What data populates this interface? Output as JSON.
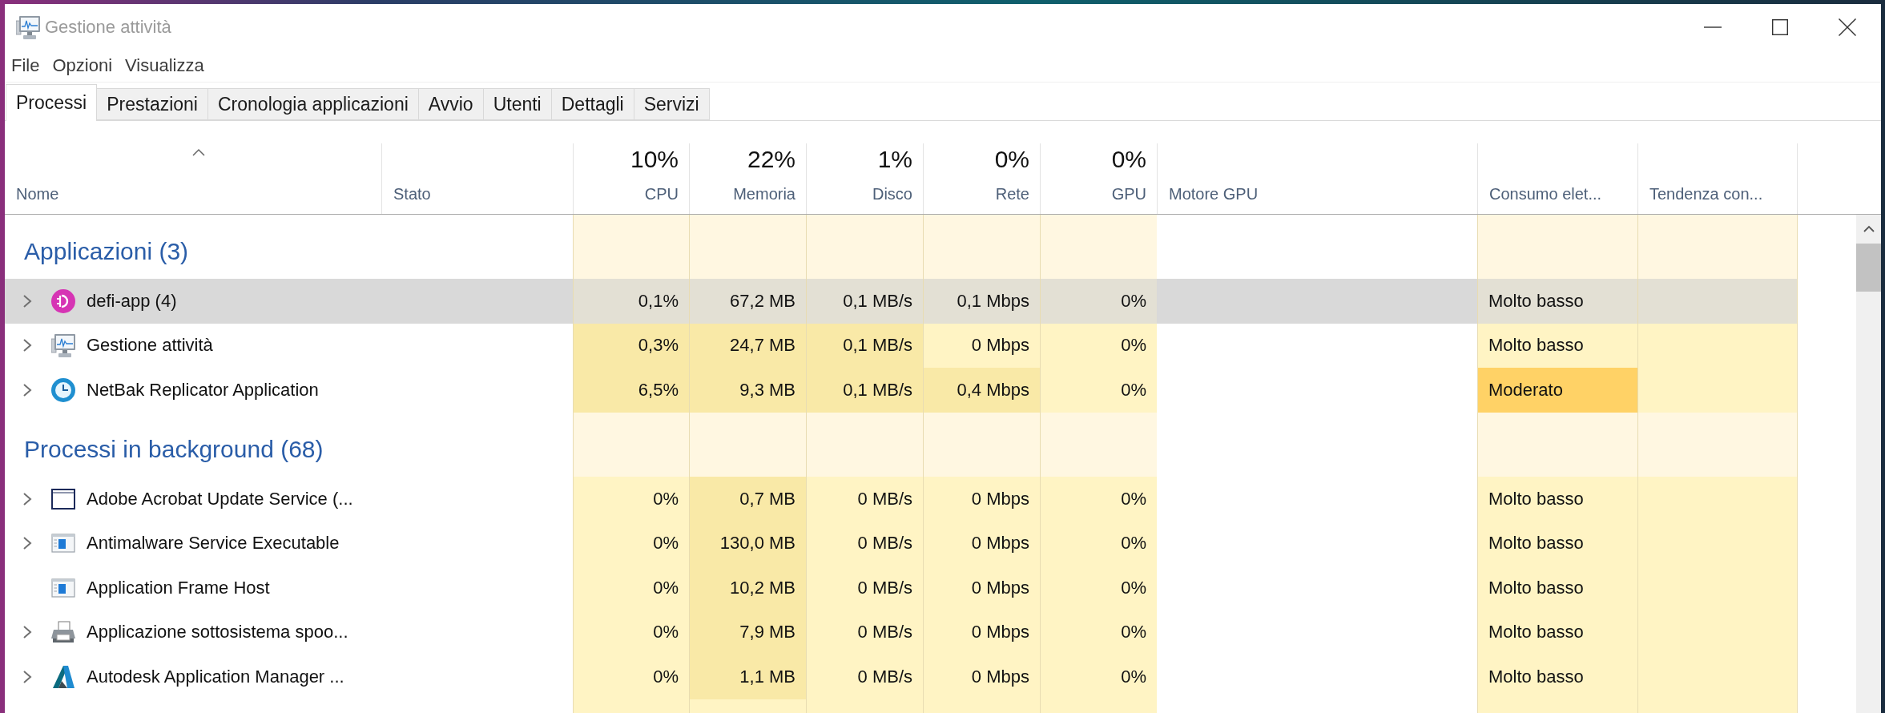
{
  "window": {
    "title": "Gestione attività"
  },
  "menu": [
    "File",
    "Opzioni",
    "Visualizza"
  ],
  "tabs": [
    {
      "label": "Processi",
      "selected": true
    },
    {
      "label": "Prestazioni",
      "selected": false
    },
    {
      "label": "Cronologia applicazioni",
      "selected": false
    },
    {
      "label": "Avvio",
      "selected": false
    },
    {
      "label": "Utenti",
      "selected": false
    },
    {
      "label": "Dettagli",
      "selected": false
    },
    {
      "label": "Servizi",
      "selected": false
    }
  ],
  "table": {
    "columns": [
      {
        "kind": "name",
        "label": "Nome",
        "sorted": true
      },
      {
        "kind": "status",
        "label": "Stato",
        "sorted": false
      },
      {
        "kind": "metric",
        "label": "CPU",
        "total": "10%",
        "sorted": false
      },
      {
        "kind": "metric",
        "label": "Memoria",
        "total": "22%",
        "sorted": false
      },
      {
        "kind": "metric",
        "label": "Disco",
        "total": "1%",
        "sorted": false
      },
      {
        "kind": "metric",
        "label": "Rete",
        "total": "0%",
        "sorted": false
      },
      {
        "kind": "metric",
        "label": "GPU",
        "total": "0%",
        "sorted": false
      },
      {
        "kind": "engine",
        "label": "Motore GPU",
        "sorted": false
      },
      {
        "kind": "power",
        "label": "Consumo elet...",
        "sorted": false
      },
      {
        "kind": "trend",
        "label": "Tendenza con...",
        "sorted": false
      }
    ],
    "groups": [
      {
        "title": "Applicazioni (3)",
        "rows": [
          {
            "name": "defi-app (4)",
            "expandable": true,
            "selected": true,
            "metrics": [
              {
                "text": "0,1%",
                "color": "#e3e0d4"
              },
              {
                "text": "67,2 MB",
                "color": "#e3e0d4"
              },
              {
                "text": "0,1 MB/s",
                "color": "#e3e0d4"
              },
              {
                "text": "0,1 Mbps",
                "color": "#e3e0d4"
              },
              {
                "text": "0%",
                "color": "#e3e0d4"
              }
            ],
            "power": {
              "text": "Molto basso",
              "color": "#e3e0d4"
            },
            "power_trend": {
              "color": "#e3e0d4"
            }
          },
          {
            "name": "Gestione attività",
            "expandable": true,
            "selected": false,
            "metrics": [
              {
                "text": "0,3%",
                "color": "#f9e9a7"
              },
              {
                "text": "24,7 MB",
                "color": "#f9e9a7"
              },
              {
                "text": "0,1 MB/s",
                "color": "#f9e9a7"
              },
              {
                "text": "0 Mbps",
                "color": "#fff4c4"
              },
              {
                "text": "0%",
                "color": "#fff4c4"
              }
            ],
            "power": {
              "text": "Molto basso",
              "color": "#fff4c4"
            },
            "power_trend": {
              "color": "#fff4c4"
            }
          },
          {
            "name": "NetBak Replicator Application",
            "expandable": true,
            "selected": false,
            "metrics": [
              {
                "text": "6,5%",
                "color": "#f9e9a7"
              },
              {
                "text": "9,3 MB",
                "color": "#f9e9a7"
              },
              {
                "text": "0,1 MB/s",
                "color": "#f9e9a7"
              },
              {
                "text": "0,4 Mbps",
                "color": "#f9e9a7"
              },
              {
                "text": "0%",
                "color": "#fff4c4"
              }
            ],
            "power": {
              "text": "Moderato",
              "color": "#ffd266"
            },
            "power_trend": {
              "color": "#fff4c4"
            }
          }
        ]
      },
      {
        "title": "Processi in background (68)",
        "rows": [
          {
            "name": "Adobe Acrobat Update Service (...",
            "expandable": true,
            "selected": false,
            "metrics": [
              {
                "text": "0%",
                "color": "#fff4c4"
              },
              {
                "text": "0,7 MB",
                "color": "#f9e9a7"
              },
              {
                "text": "0 MB/s",
                "color": "#fff4c4"
              },
              {
                "text": "0 Mbps",
                "color": "#fff4c4"
              },
              {
                "text": "0%",
                "color": "#fff4c4"
              }
            ],
            "power": {
              "text": "Molto basso",
              "color": "#fff4c4"
            },
            "power_trend": {
              "color": "#fff4c4"
            }
          },
          {
            "name": "Antimalware Service Executable",
            "expandable": true,
            "selected": false,
            "metrics": [
              {
                "text": "0%",
                "color": "#fff4c4"
              },
              {
                "text": "130,0 MB",
                "color": "#f9e9a7"
              },
              {
                "text": "0 MB/s",
                "color": "#fff4c4"
              },
              {
                "text": "0 Mbps",
                "color": "#fff4c4"
              },
              {
                "text": "0%",
                "color": "#fff4c4"
              }
            ],
            "power": {
              "text": "Molto basso",
              "color": "#fff4c4"
            },
            "power_trend": {
              "color": "#fff4c4"
            }
          },
          {
            "name": "Application Frame Host",
            "expandable": false,
            "selected": false,
            "metrics": [
              {
                "text": "0%",
                "color": "#fff4c4"
              },
              {
                "text": "10,2 MB",
                "color": "#f9e9a7"
              },
              {
                "text": "0 MB/s",
                "color": "#fff4c4"
              },
              {
                "text": "0 Mbps",
                "color": "#fff4c4"
              },
              {
                "text": "0%",
                "color": "#fff4c4"
              }
            ],
            "power": {
              "text": "Molto basso",
              "color": "#fff4c4"
            },
            "power_trend": {
              "color": "#fff4c4"
            }
          },
          {
            "name": "Applicazione sottosistema spoo...",
            "expandable": true,
            "selected": false,
            "metrics": [
              {
                "text": "0%",
                "color": "#fff4c4"
              },
              {
                "text": "7,9 MB",
                "color": "#f9e9a7"
              },
              {
                "text": "0 MB/s",
                "color": "#fff4c4"
              },
              {
                "text": "0 Mbps",
                "color": "#fff4c4"
              },
              {
                "text": "0%",
                "color": "#fff4c4"
              }
            ],
            "power": {
              "text": "Molto basso",
              "color": "#fff4c4"
            },
            "power_trend": {
              "color": "#fff4c4"
            }
          },
          {
            "name": "Autodesk Application Manager ...",
            "expandable": true,
            "selected": false,
            "metrics": [
              {
                "text": "0%",
                "color": "#fff4c4"
              },
              {
                "text": "1,1 MB",
                "color": "#f9e9a7"
              },
              {
                "text": "0 MB/s",
                "color": "#fff4c4"
              },
              {
                "text": "0 Mbps",
                "color": "#fff4c4"
              },
              {
                "text": "0%",
                "color": "#fff4c4"
              }
            ],
            "power": {
              "text": "Molto basso",
              "color": "#fff4c4"
            },
            "power_trend": {
              "color": "#fff4c4"
            }
          }
        ]
      }
    ]
  }
}
